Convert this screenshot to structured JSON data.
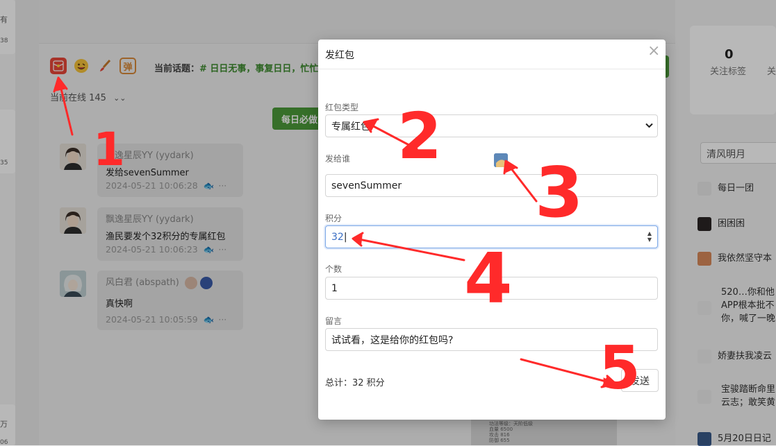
{
  "left_strip": {
    "a": "有",
    "b": "38",
    "c": "35",
    "d": "万",
    "e": "06"
  },
  "toolbar": {
    "redpacket_icon": "red-packet-icon",
    "emoji_icon": "emoji-icon",
    "brush_icon": "brush-icon",
    "danmu_label": "弹",
    "topic_label": "当前话题：",
    "topic_value": "# 日日无事，事复日日，忙忙"
  },
  "online": {
    "text": "当前在线 145"
  },
  "daily_btn": "每日必做",
  "messages": [
    {
      "name": "飘逸星辰YY (yydark)",
      "text": "发给sevenSummer",
      "time": "2024-05-21 10:06:28"
    },
    {
      "name": "飘逸星辰YY (yydark)",
      "text": "渔民要发个32积分的专属红包",
      "time": "2024-05-21 10:06:23"
    },
    {
      "name": "风白君 (abspath)",
      "text": "真快啊",
      "time": "2024-05-21 10:05:59"
    }
  ],
  "right": {
    "tags_count": "0",
    "tags_label": "关注标签",
    "follow_label": "关",
    "search_value": "清风明月",
    "items": [
      "每日一团",
      "困困困",
      "我依然坚守本",
      "520…你和他",
      "APP根本批不",
      "你，喊了一晚",
      "娇妻扶我凌云",
      "宝骏踏断命里",
      "云志；敢笑黄",
      "5月20日日记"
    ]
  },
  "modal": {
    "title": "发红包",
    "close": "×",
    "type_label": "红包类型",
    "type_value": "专属红包",
    "to_label": "发给谁",
    "to_value": "sevenSummer",
    "points_label": "积分",
    "points_value": "32",
    "count_label": "个数",
    "count_value": "1",
    "message_label": "留言",
    "message_value": "试试看，这是给你的红包吗?",
    "total": "总计：32 积分",
    "send": "发送"
  },
  "annotations": {
    "n1": "1",
    "n2": "2",
    "n3": "3",
    "n4": "4",
    "n5": "5"
  },
  "colors": {
    "accent_green": "#4c9a3a",
    "annotation_red": "#ff2a2a",
    "focus_blue": "#7aa7e6"
  }
}
